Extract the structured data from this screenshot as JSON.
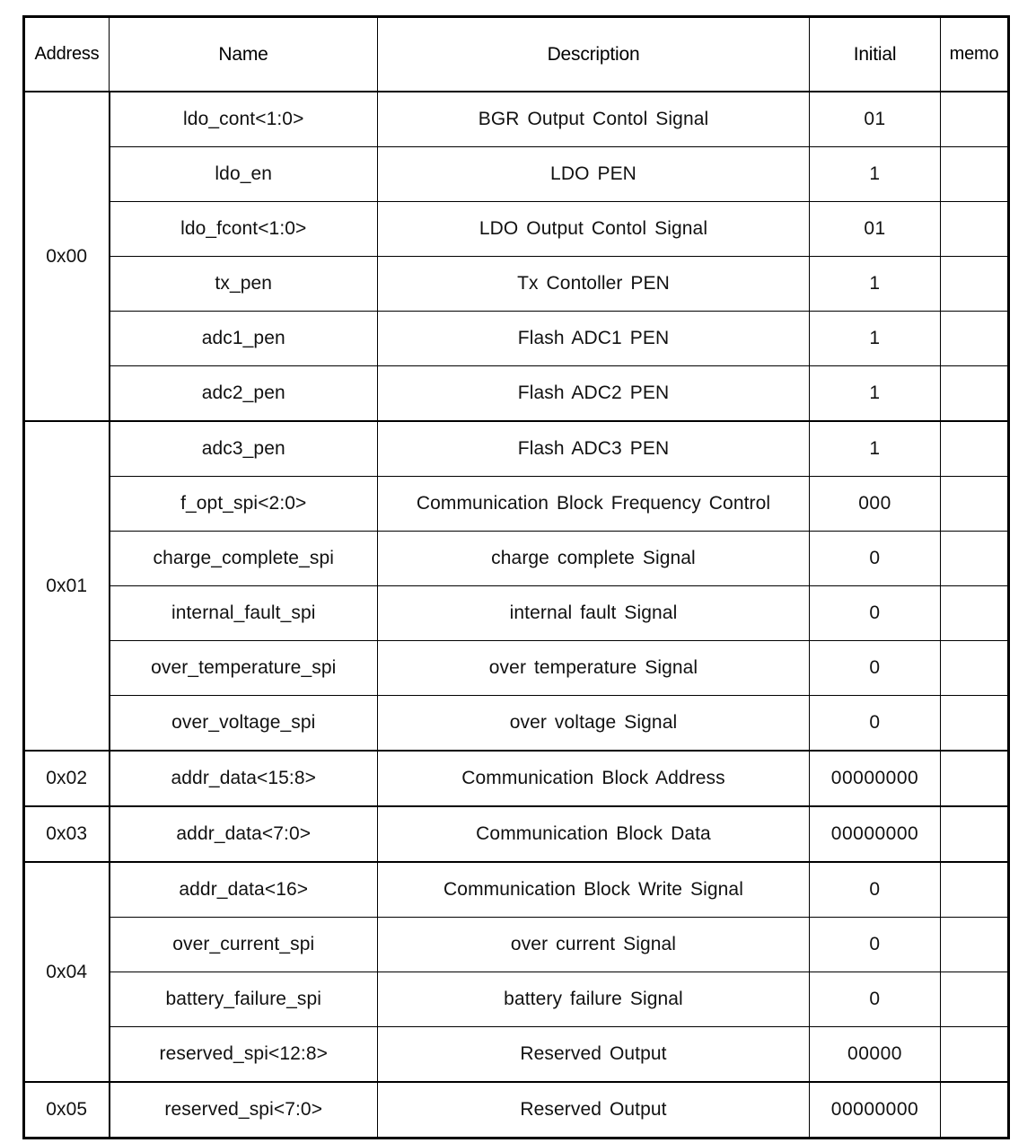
{
  "table": {
    "columns": [
      {
        "key": "address",
        "label": "Address"
      },
      {
        "key": "name",
        "label": "Name"
      },
      {
        "key": "description",
        "label": "Description"
      },
      {
        "key": "initial",
        "label": "Initial"
      },
      {
        "key": "memo",
        "label": "memo"
      }
    ],
    "header_background": "#d4d4d4",
    "border_color": "#000000",
    "groups": [
      {
        "address": "0x00",
        "rows": [
          {
            "name": "ldo_cont<1:0>",
            "description": "BGR Output Contol Signal",
            "initial": "01",
            "memo": ""
          },
          {
            "name": "ldo_en",
            "description": "LDO PEN",
            "initial": "1",
            "memo": ""
          },
          {
            "name": "ldo_fcont<1:0>",
            "description": "LDO Output Contol Signal",
            "initial": "01",
            "memo": ""
          },
          {
            "name": "tx_pen",
            "description": "Tx Contoller PEN",
            "initial": "1",
            "memo": ""
          },
          {
            "name": "adc1_pen",
            "description": "Flash ADC1 PEN",
            "initial": "1",
            "memo": ""
          },
          {
            "name": "adc2_pen",
            "description": "Flash ADC2 PEN",
            "initial": "1",
            "memo": ""
          }
        ]
      },
      {
        "address": "0x01",
        "rows": [
          {
            "name": "adc3_pen",
            "description": "Flash ADC3 PEN",
            "initial": "1",
            "memo": ""
          },
          {
            "name": "f_opt_spi<2:0>",
            "description": "Communication Block Frequency Control",
            "initial": "000",
            "memo": ""
          },
          {
            "name": "charge_complete_spi",
            "description": "charge complete Signal",
            "initial": "0",
            "memo": ""
          },
          {
            "name": "internal_fault_spi",
            "description": "internal fault Signal",
            "initial": "0",
            "memo": ""
          },
          {
            "name": "over_temperature_spi",
            "description": "over temperature Signal",
            "initial": "0",
            "memo": ""
          },
          {
            "name": "over_voltage_spi",
            "description": "over voltage Signal",
            "initial": "0",
            "memo": ""
          }
        ]
      },
      {
        "address": "0x02",
        "rows": [
          {
            "name": "addr_data<15:8>",
            "description": "Communication Block Address",
            "initial": "00000000",
            "memo": ""
          }
        ]
      },
      {
        "address": "0x03",
        "rows": [
          {
            "name": "addr_data<7:0>",
            "description": "Communication Block Data",
            "initial": "00000000",
            "memo": ""
          }
        ]
      },
      {
        "address": "0x04",
        "rows": [
          {
            "name": "addr_data<16>",
            "description": "Communication Block Write Signal",
            "initial": "0",
            "memo": ""
          },
          {
            "name": "over_current_spi",
            "description": "over current Signal",
            "initial": "0",
            "memo": ""
          },
          {
            "name": "battery_failure_spi",
            "description": "battery failure Signal",
            "initial": "0",
            "memo": ""
          },
          {
            "name": "reserved_spi<12:8>",
            "description": "Reserved Output",
            "initial": "00000",
            "memo": ""
          }
        ]
      },
      {
        "address": "0x05",
        "rows": [
          {
            "name": "reserved_spi<7:0>",
            "description": "Reserved Output",
            "initial": "00000000",
            "memo": ""
          }
        ]
      }
    ]
  }
}
